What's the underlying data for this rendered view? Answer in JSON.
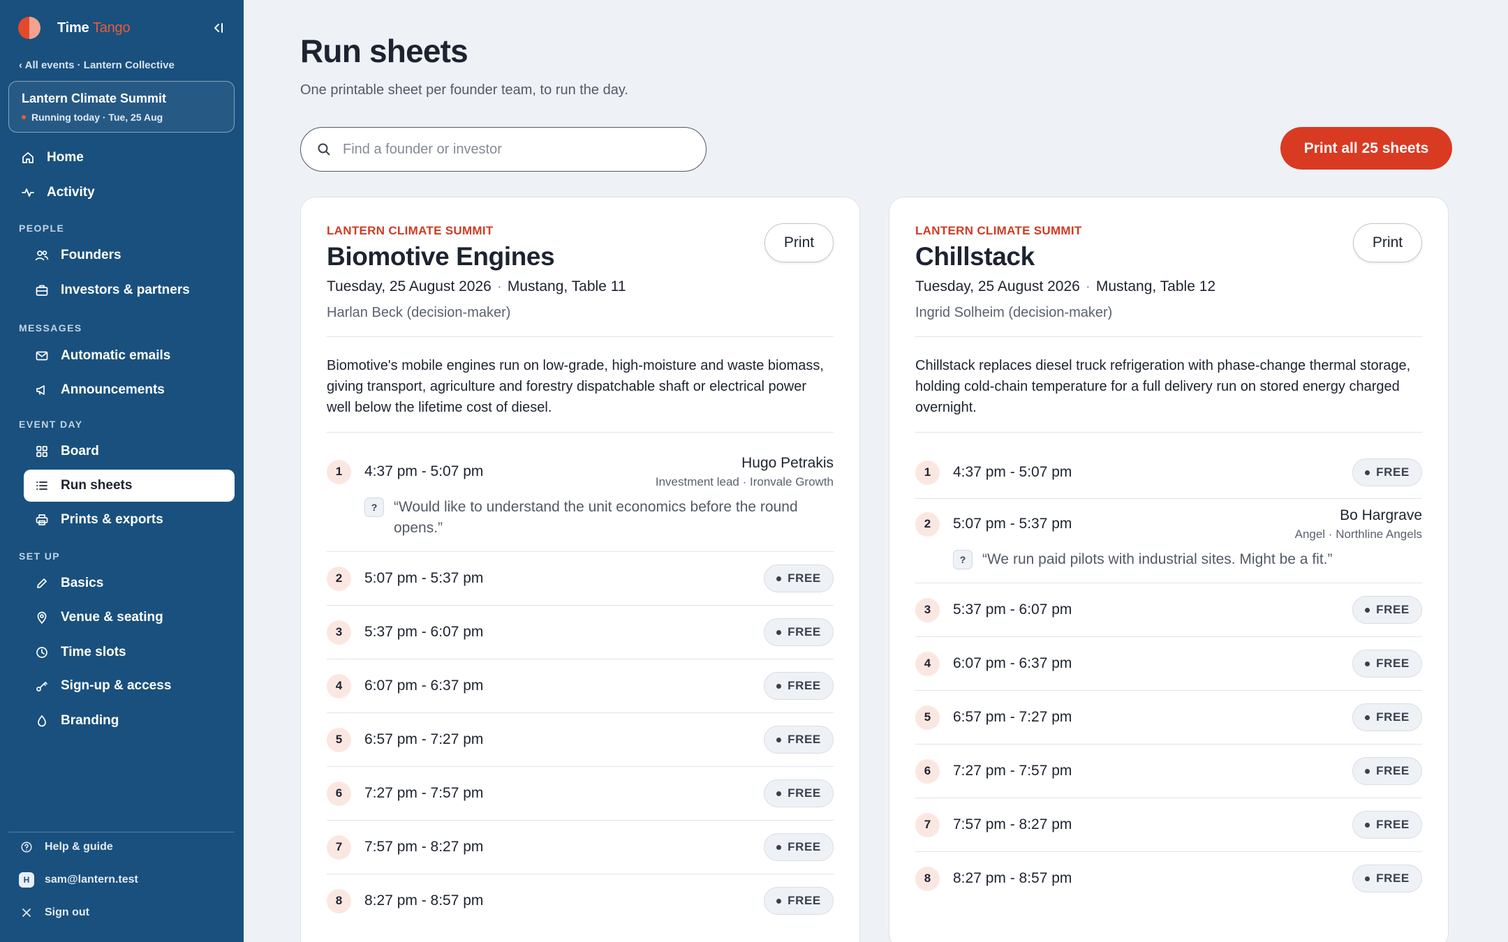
{
  "app": {
    "name_primary": "Time",
    "name_accent": "Tango"
  },
  "sidebar": {
    "back_link": "‹ All events · Lantern Collective",
    "event": {
      "name": "Lantern Climate Summit",
      "status": "Running today · Tue, 25 Aug",
      "status_color": "#ec5a3c"
    },
    "nav_top": [
      {
        "label": "Home",
        "icon": "home-icon"
      },
      {
        "label": "Activity",
        "icon": "activity-icon"
      }
    ],
    "sections": [
      {
        "title": "PEOPLE",
        "items": [
          {
            "label": "Founders",
            "icon": "users-icon"
          },
          {
            "label": "Investors & partners",
            "icon": "briefcase-icon"
          }
        ]
      },
      {
        "title": "MESSAGES",
        "items": [
          {
            "label": "Automatic emails",
            "icon": "mail-icon"
          },
          {
            "label": "Announcements",
            "icon": "megaphone-icon"
          }
        ]
      },
      {
        "title": "EVENT DAY",
        "items": [
          {
            "label": "Board",
            "icon": "grid-icon"
          },
          {
            "label": "Run sheets",
            "icon": "list-icon",
            "active": true
          },
          {
            "label": "Prints & exports",
            "icon": "printer-icon"
          }
        ]
      },
      {
        "title": "SET UP",
        "items": [
          {
            "label": "Basics",
            "icon": "pencil-icon"
          },
          {
            "label": "Venue & seating",
            "icon": "map-pin-icon"
          },
          {
            "label": "Time slots",
            "icon": "clock-icon"
          },
          {
            "label": "Sign-up & access",
            "icon": "key-icon"
          },
          {
            "label": "Branding",
            "icon": "droplet-icon"
          }
        ]
      }
    ],
    "footer": {
      "help": "Help & guide",
      "user_initial": "H",
      "user": "sam@lantern.test",
      "sign_out": "Sign out"
    }
  },
  "main": {
    "title": "Run sheets",
    "subtitle": "One printable sheet per founder team, to run the day.",
    "search_placeholder": "Find a founder or investor",
    "print_all": "Print all 25 sheets",
    "accent_color": "#d93a22"
  },
  "sheets": [
    {
      "event": "LANTERN CLIMATE SUMMIT",
      "team": "Biomotive Engines",
      "date": "Tuesday, 25 August 2026",
      "location": "Mustang, Table 11",
      "decision_maker": "Harlan Beck (decision-maker)",
      "print_label": "Print",
      "blurb": "Biomotive's mobile engines run on low-grade, high-moisture and waste biomass, giving transport, agriculture and forestry dispatchable shaft or electrical power well below the lifetime cost of diesel.",
      "slots": [
        {
          "num": "1",
          "time": "4:37 pm - 5:07 pm",
          "investor": "Hugo Petrakis",
          "role": "Investment lead · Ironvale Growth",
          "note": "“Would like to understand the unit economics before the round opens.”"
        },
        {
          "num": "2",
          "time": "5:07 pm - 5:37 pm",
          "status": "FREE"
        },
        {
          "num": "3",
          "time": "5:37 pm - 6:07 pm",
          "status": "FREE"
        },
        {
          "num": "4",
          "time": "6:07 pm - 6:37 pm",
          "status": "FREE"
        },
        {
          "num": "5",
          "time": "6:57 pm - 7:27 pm",
          "status": "FREE"
        },
        {
          "num": "6",
          "time": "7:27 pm - 7:57 pm",
          "status": "FREE"
        },
        {
          "num": "7",
          "time": "7:57 pm - 8:27 pm",
          "status": "FREE"
        },
        {
          "num": "8",
          "time": "8:27 pm - 8:57 pm",
          "status": "FREE"
        }
      ]
    },
    {
      "event": "LANTERN CLIMATE SUMMIT",
      "team": "Chillstack",
      "date": "Tuesday, 25 August 2026",
      "location": "Mustang, Table 12",
      "decision_maker": "Ingrid Solheim (decision-maker)",
      "print_label": "Print",
      "blurb": "Chillstack replaces diesel truck refrigeration with phase-change thermal storage, holding cold-chain temperature for a full delivery run on stored energy charged overnight.",
      "slots": [
        {
          "num": "1",
          "time": "4:37 pm - 5:07 pm",
          "status": "FREE"
        },
        {
          "num": "2",
          "time": "5:07 pm - 5:37 pm",
          "investor": "Bo Hargrave",
          "role": "Angel · Northline Angels",
          "note": "“We run paid pilots with industrial sites. Might be a fit.”"
        },
        {
          "num": "3",
          "time": "5:37 pm - 6:07 pm",
          "status": "FREE"
        },
        {
          "num": "4",
          "time": "6:07 pm - 6:37 pm",
          "status": "FREE"
        },
        {
          "num": "5",
          "time": "6:57 pm - 7:27 pm",
          "status": "FREE"
        },
        {
          "num": "6",
          "time": "7:27 pm - 7:57 pm",
          "status": "FREE"
        },
        {
          "num": "7",
          "time": "7:57 pm - 8:27 pm",
          "status": "FREE"
        },
        {
          "num": "8",
          "time": "8:27 pm - 8:57 pm",
          "status": "FREE"
        }
      ]
    }
  ]
}
